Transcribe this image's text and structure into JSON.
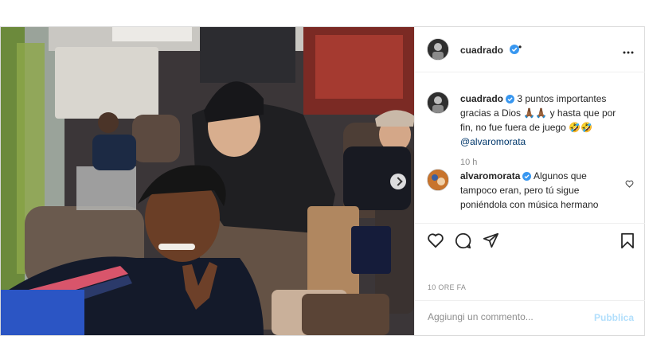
{
  "post": {
    "author": "cuadrado",
    "header_separator": "•",
    "caption": {
      "user": "cuadrado",
      "text": "3 puntos importantes gracias a Dios 🙏🏾🙏🏾 y hasta que por fin, no fue fuera de juego 🤣🤣",
      "mention": "@alvaromorata",
      "time": "10 h"
    },
    "comments": [
      {
        "user": "alvaromorata",
        "text": "Algunos que tampoco eran, pero tú sigue poniéndola con música hermano"
      }
    ],
    "date_label": "10 ORE FA",
    "add_comment_placeholder": "Aggiungi un commento...",
    "publish_label": "Pubblica"
  },
  "colors": {
    "verified": "#3897f0",
    "publish_disabled": "#b2dffc",
    "mention": "#00376b"
  }
}
